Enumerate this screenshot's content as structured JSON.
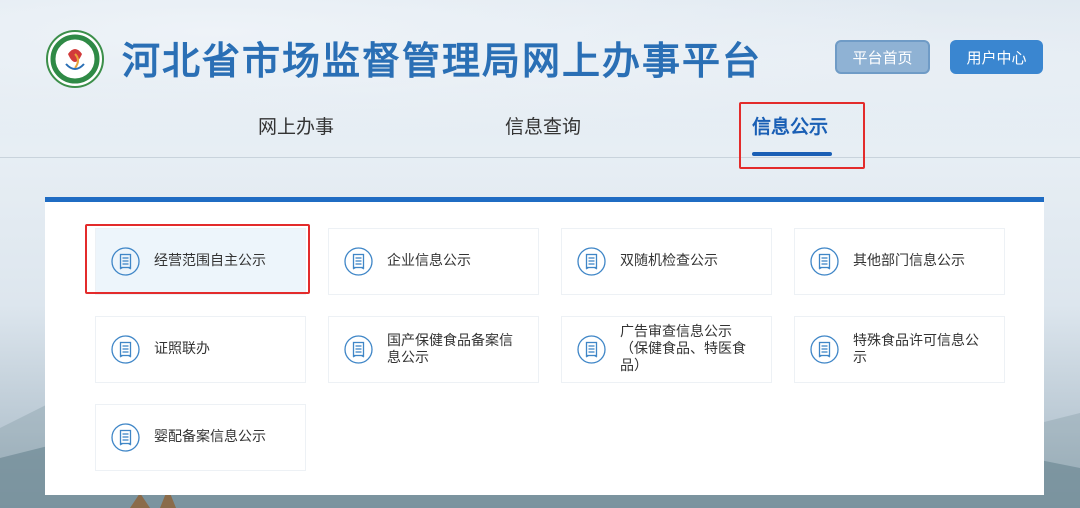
{
  "header": {
    "site_title": "河北省市场监督管理局网上办事平台",
    "home_button": "平台首页",
    "user_button": "用户中心"
  },
  "nav": {
    "tabs": [
      {
        "label": "网上办事"
      },
      {
        "label": "信息查询"
      },
      {
        "label": "信息公示",
        "active": true
      }
    ]
  },
  "cards": [
    {
      "label": "经营范围自主公示",
      "icon": "document-icon",
      "active": true
    },
    {
      "label": "企业信息公示",
      "icon": "document-icon"
    },
    {
      "label": "双随机检查公示",
      "icon": "document-icon"
    },
    {
      "label": "其他部门信息公示",
      "icon": "document-icon"
    },
    {
      "label": "证照联办",
      "icon": "document-icon"
    },
    {
      "label": "国产保健食品备案信息公示",
      "icon": "document-icon"
    },
    {
      "label": "广告审查信息公示（保健食品、特医食品）",
      "icon": "document-icon"
    },
    {
      "label": "特殊食品许可信息公示",
      "icon": "document-icon"
    },
    {
      "label": "婴配备案信息公示",
      "icon": "document-icon"
    }
  ],
  "colors": {
    "brand_blue": "#1f6cc3",
    "title_blue": "#2a6fb5",
    "highlight_red": "#e32b2b",
    "icon_blue": "#3f86c7"
  }
}
